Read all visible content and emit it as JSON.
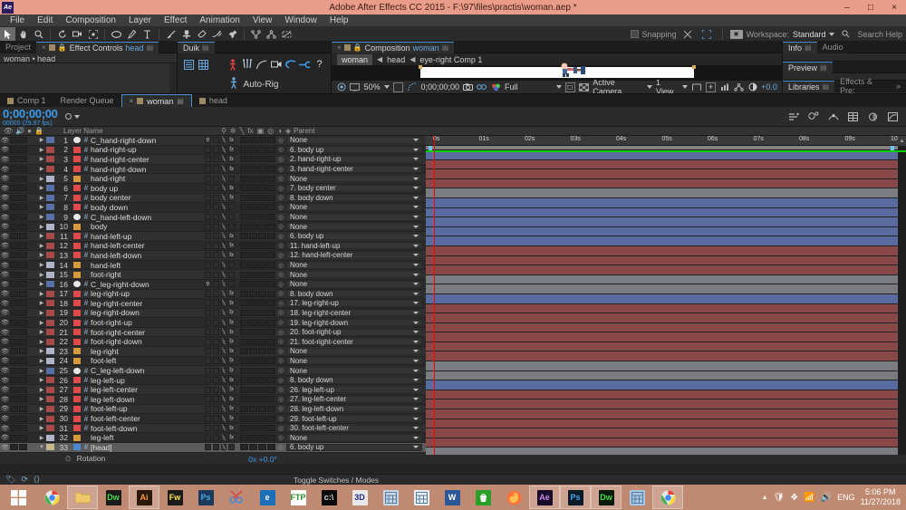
{
  "window": {
    "title": "Adobe After Effects CC 2015 - F:\\97\\files\\practis\\woman.aep *",
    "logo": "Ae",
    "minimize": "–",
    "maximize": "□",
    "close": "×"
  },
  "menubar": {
    "items": [
      "File",
      "Edit",
      "Composition",
      "Layer",
      "Effect",
      "Animation",
      "View",
      "Window",
      "Help"
    ]
  },
  "toolbar": {
    "snapping_label": "Snapping",
    "workspace_label": "Workspace:",
    "workspace_value": "Standard",
    "search_help": "Search Help",
    "tools": [
      "selection-tool",
      "hand-tool",
      "zoom-tool",
      "rotation-tool",
      "camera-tool",
      "pan-behind-tool",
      "shape-tool",
      "pen-tool",
      "type-tool",
      "brush-tool",
      "clone-stamp-tool",
      "eraser-tool",
      "roto-brush-tool",
      "puppet-pin-tool"
    ]
  },
  "effect_controls": {
    "tabs": [
      {
        "label": "Project",
        "active": false
      },
      {
        "label": "Effect Controls",
        "sub": "head",
        "active": true
      }
    ],
    "path": "woman • head"
  },
  "duik": {
    "tab": "Duik",
    "autorig_label": "Auto-Rig",
    "help_glyph": "?"
  },
  "composition": {
    "tab_label": "Composition",
    "tab_sub": "woman",
    "breadcrumbs": [
      "woman",
      "head",
      "eye-right Comp 1"
    ],
    "controls": {
      "zoom": "50%",
      "time": "0;00;00;00",
      "resolution": "Full",
      "camera": "Active Camera",
      "views": "1 View",
      "exposure": "+0.0"
    }
  },
  "right_panels": {
    "row1": [
      "Info",
      "Audio"
    ],
    "row2": [
      "Preview"
    ],
    "row3": [
      "Libraries",
      "Effects & Pre:"
    ],
    "overflow": "»"
  },
  "timeline": {
    "tabs": [
      {
        "label": "Comp 1",
        "active": false,
        "swatch": true
      },
      {
        "label": "Render Queue",
        "active": false,
        "swatch": false
      },
      {
        "label": "woman",
        "active": true,
        "swatch": true
      },
      {
        "label": "head",
        "active": false,
        "swatch": true
      }
    ],
    "timecode": "0;00;00;00",
    "frame_info": "00000 (29.97 fps)",
    "columns": {
      "layer_name": "Layer Name",
      "parent": "Parent"
    },
    "ruler_ticks": [
      "0s",
      "01s",
      "02s",
      "03s",
      "04s",
      "05s",
      "06s",
      "07s",
      "08s",
      "09s",
      "10s"
    ],
    "footer": {
      "toggle": "Toggle Switches / Modes"
    },
    "property": {
      "name": "Rotation",
      "value": "0x +0.0°"
    },
    "layers": [
      {
        "num": "1",
        "name": "C_hand-right-down",
        "color": "#5a6fa8",
        "bar": "#5a6ba0",
        "parent": "None",
        "fx": true,
        "type": "null",
        "shy": true
      },
      {
        "num": "2",
        "name": "hand-right-up",
        "color": "#a94a4a",
        "bar": "#8b4848",
        "parent": "6. body up",
        "fx": true,
        "type": "solid"
      },
      {
        "num": "3",
        "name": "hand-right-center",
        "color": "#a94a4a",
        "bar": "#8b4848",
        "parent": "2. hand-right-up",
        "fx": true,
        "type": "solid"
      },
      {
        "num": "4",
        "name": "hand-right-down",
        "color": "#a94a4a",
        "bar": "#8b4848",
        "parent": "3. hand-right-center",
        "fx": true,
        "type": "solid"
      },
      {
        "num": "5",
        "name": "hand-right",
        "color": "#b0b4c8",
        "bar": "#7b7b82",
        "parent": "None",
        "fx": false,
        "type": "folder"
      },
      {
        "num": "6",
        "name": "body up",
        "color": "#5a6fa8",
        "bar": "#5a6ba0",
        "parent": "7. body center",
        "fx": true,
        "type": "solid"
      },
      {
        "num": "7",
        "name": "body center",
        "color": "#5a6fa8",
        "bar": "#5a6ba0",
        "parent": "8. body down",
        "fx": true,
        "type": "solid"
      },
      {
        "num": "8",
        "name": "body down",
        "color": "#5a6fa8",
        "bar": "#5a6ba0",
        "parent": "None",
        "fx": false,
        "type": "solid"
      },
      {
        "num": "9",
        "name": "C_hand-left-down",
        "color": "#5a6fa8",
        "bar": "#5a6ba0",
        "parent": "None",
        "fx": false,
        "type": "null"
      },
      {
        "num": "10",
        "name": "body",
        "color": "#b0b4c8",
        "bar": "#5a6ba0",
        "parent": "None",
        "fx": false,
        "type": "folder"
      },
      {
        "num": "11",
        "name": "hand-left-up",
        "color": "#a94a4a",
        "bar": "#8b4848",
        "parent": "6. body up",
        "fx": true,
        "type": "solid"
      },
      {
        "num": "12",
        "name": "hand-left-center",
        "color": "#a94a4a",
        "bar": "#8b4848",
        "parent": "11. hand-left-up",
        "fx": true,
        "type": "solid"
      },
      {
        "num": "13",
        "name": "hand-left-down",
        "color": "#a94a4a",
        "bar": "#8b4848",
        "parent": "12. hand-left-center",
        "fx": true,
        "type": "solid"
      },
      {
        "num": "14",
        "name": "hand-left",
        "color": "#b0b4c8",
        "bar": "#7b7b82",
        "parent": "None",
        "fx": false,
        "type": "folder"
      },
      {
        "num": "15",
        "name": "foot-right",
        "color": "#b0b4c8",
        "bar": "#7b7b82",
        "parent": "None",
        "fx": false,
        "type": "folder"
      },
      {
        "num": "16",
        "name": "C_leg-right-down",
        "color": "#5a6fa8",
        "bar": "#5a6ba0",
        "parent": "None",
        "fx": false,
        "type": "null",
        "shy": true
      },
      {
        "num": "17",
        "name": "leg-right-up",
        "color": "#a94a4a",
        "bar": "#8b4848",
        "parent": "8. body down",
        "fx": true,
        "type": "solid"
      },
      {
        "num": "18",
        "name": "leg-right-center",
        "color": "#a94a4a",
        "bar": "#8b4848",
        "parent": "17. leg-right-up",
        "fx": true,
        "type": "solid"
      },
      {
        "num": "19",
        "name": "leg-right-down",
        "color": "#a94a4a",
        "bar": "#8b4848",
        "parent": "18. leg-right-center",
        "fx": true,
        "type": "solid"
      },
      {
        "num": "20",
        "name": "foot-right-up",
        "color": "#a94a4a",
        "bar": "#8b4848",
        "parent": "19. leg-right-down",
        "fx": true,
        "type": "solid"
      },
      {
        "num": "21",
        "name": "foot-right-center",
        "color": "#a94a4a",
        "bar": "#8b4848",
        "parent": "20. foot-right-up",
        "fx": true,
        "type": "solid"
      },
      {
        "num": "22",
        "name": "foot-right-down",
        "color": "#a94a4a",
        "bar": "#8b4848",
        "parent": "21. foot-right-center",
        "fx": true,
        "type": "solid"
      },
      {
        "num": "23",
        "name": "leg-right",
        "color": "#b0b4c8",
        "bar": "#7b7b82",
        "parent": "None",
        "fx": true,
        "type": "folder"
      },
      {
        "num": "24",
        "name": "foot-left",
        "color": "#b0b4c8",
        "bar": "#7b7b82",
        "parent": "None",
        "fx": true,
        "type": "folder"
      },
      {
        "num": "25",
        "name": "C_leg-left-down",
        "color": "#5a6fa8",
        "bar": "#5a6ba0",
        "parent": "None",
        "fx": true,
        "type": "null"
      },
      {
        "num": "26",
        "name": "leg-left-up",
        "color": "#a94a4a",
        "bar": "#8b4848",
        "parent": "8. body down",
        "fx": true,
        "type": "solid"
      },
      {
        "num": "27",
        "name": "leg-left-center",
        "color": "#a94a4a",
        "bar": "#8b4848",
        "parent": "26. leg-left-up",
        "fx": true,
        "type": "solid"
      },
      {
        "num": "28",
        "name": "leg-left-down",
        "color": "#a94a4a",
        "bar": "#8b4848",
        "parent": "27. leg-left-center",
        "fx": true,
        "type": "solid"
      },
      {
        "num": "29",
        "name": "foot-left-up",
        "color": "#a94a4a",
        "bar": "#8b4848",
        "parent": "28. leg-left-down",
        "fx": true,
        "type": "solid"
      },
      {
        "num": "30",
        "name": "foot-left-center",
        "color": "#a94a4a",
        "bar": "#8b4848",
        "parent": "29. foot-left-up",
        "fx": true,
        "type": "solid"
      },
      {
        "num": "31",
        "name": "foot-left-down",
        "color": "#a94a4a",
        "bar": "#8b4848",
        "parent": "30. foot-left-center",
        "fx": true,
        "type": "solid"
      },
      {
        "num": "32",
        "name": "leg-left",
        "color": "#b0b4c8",
        "bar": "#7b7b82",
        "parent": "None",
        "fx": true,
        "type": "folder"
      },
      {
        "num": "33",
        "name": "[head]",
        "color": "#c8b98f",
        "bar": "#cdbb93",
        "parent": "6. body up",
        "fx": false,
        "type": "image",
        "selected": true
      }
    ]
  },
  "taskbar": {
    "start": "⊞",
    "items": [
      {
        "name": "chrome",
        "label": "",
        "color": "#ffffff",
        "running": false
      },
      {
        "name": "file-explorer",
        "label": "",
        "color": "#f0c869",
        "running": true
      },
      {
        "name": "dreamweaver",
        "label": "Dw",
        "color": "#1a1a1a",
        "fg": "#4ade4a",
        "running": false
      },
      {
        "name": "illustrator",
        "label": "Ai",
        "color": "#2a1a0a",
        "fg": "#ff9a3c",
        "running": true
      },
      {
        "name": "fireworks",
        "label": "Fw",
        "color": "#1a1a1a",
        "fg": "#ffe14a",
        "running": false
      },
      {
        "name": "photoshop",
        "label": "Ps",
        "color": "#1b3a5c",
        "fg": "#4aa8e0",
        "running": false
      },
      {
        "name": "snipping-tool",
        "label": "",
        "color": "#d8d8d8",
        "running": false
      },
      {
        "name": "internet-explorer",
        "label": "e",
        "color": "#1a6fb8",
        "fg": "#ffffff",
        "running": false
      },
      {
        "name": "ftp-client",
        "label": "FTP",
        "color": "#ffffff",
        "fg": "#2a8a2a",
        "running": false
      },
      {
        "name": "command-prompt",
        "label": "c:\\",
        "color": "#0a0a0a",
        "fg": "#dddddd",
        "running": false
      },
      {
        "name": "3d-app",
        "label": "3D",
        "color": "#e8e8e8",
        "fg": "#2a2a8a",
        "running": false
      },
      {
        "name": "calculator",
        "label": "",
        "color": "#c8d8e8",
        "running": false
      },
      {
        "name": "notes-app",
        "label": "",
        "color": "#e8f0f8",
        "running": false
      },
      {
        "name": "word",
        "label": "W",
        "color": "#2b5797",
        "fg": "#ffffff",
        "running": false
      },
      {
        "name": "windows-store",
        "label": "",
        "color": "#2aa02a",
        "running": false
      },
      {
        "name": "firefox",
        "label": "",
        "color": "#e8701a",
        "running": false
      },
      {
        "name": "after-effects",
        "label": "Ae",
        "color": "#1a0a2a",
        "fg": "#c88ae8",
        "running": true
      },
      {
        "name": "photoshop-2",
        "label": "Ps",
        "color": "#0a1a2a",
        "fg": "#4aa8e0",
        "running": true
      },
      {
        "name": "dreamweaver-2",
        "label": "Dw",
        "color": "#0a1a0a",
        "fg": "#4ade4a",
        "running": true
      },
      {
        "name": "presentation-app",
        "label": "",
        "color": "#a8c8e8",
        "running": false
      },
      {
        "name": "chrome-2",
        "label": "",
        "color": "#ffffff",
        "running": true
      }
    ],
    "tray": {
      "chevron": "▲",
      "language": "ENG",
      "time": "5:06 PM",
      "date": "11/27/2018"
    }
  }
}
